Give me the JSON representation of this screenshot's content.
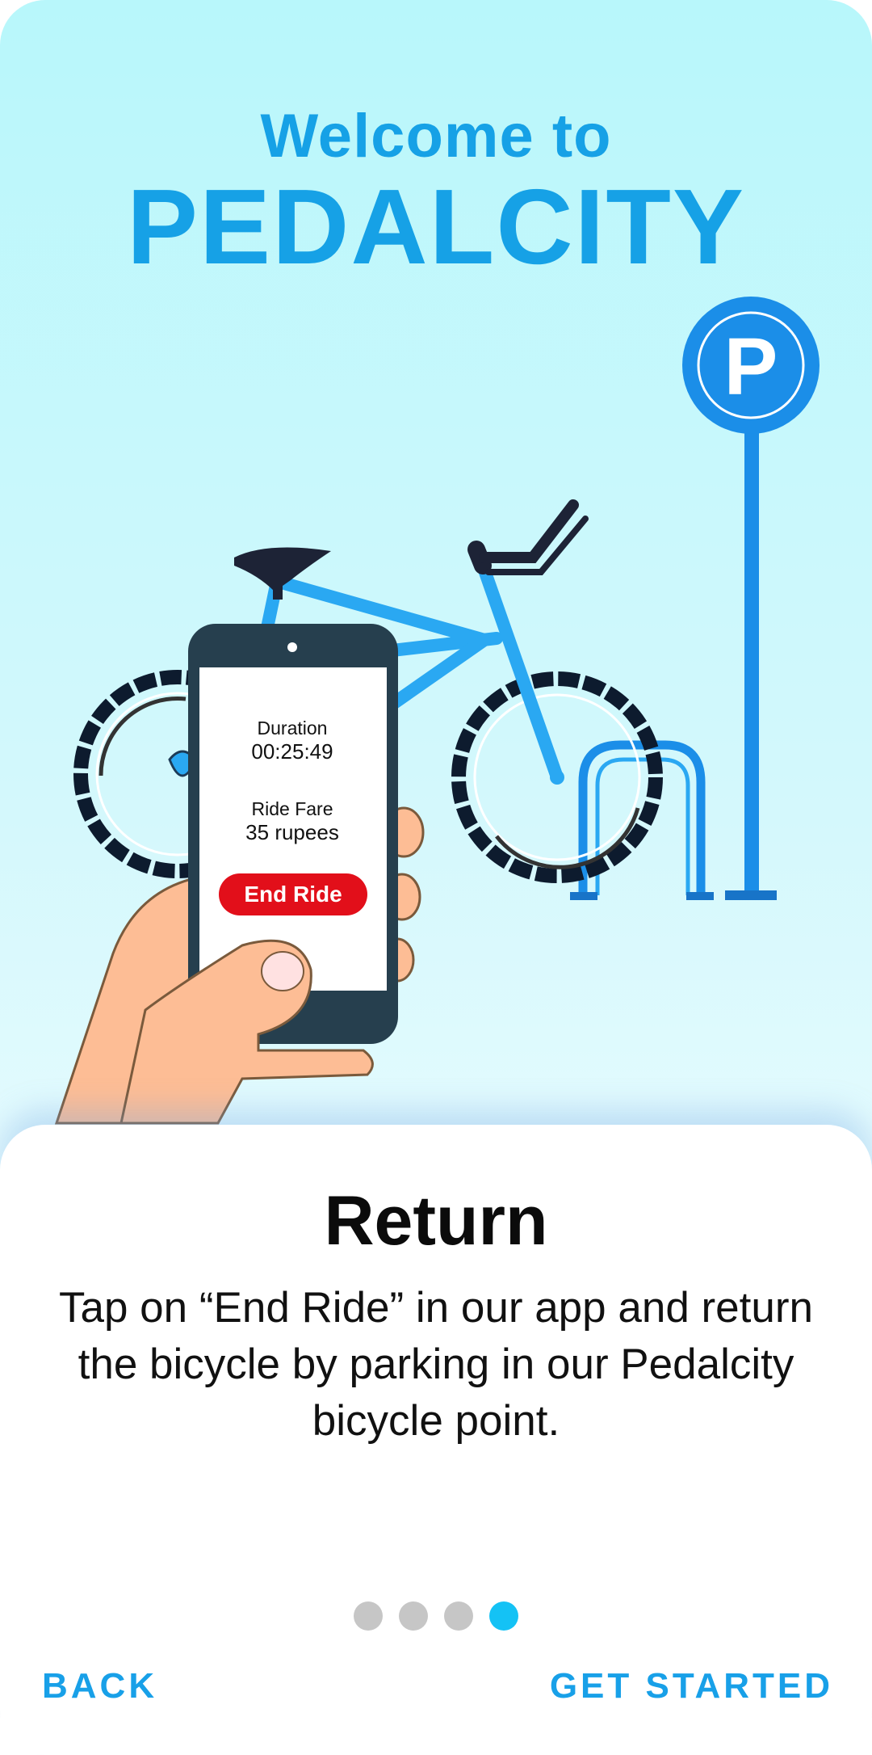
{
  "header": {
    "welcome": "Welcome to",
    "brand": "PEDALCITY"
  },
  "illustration": {
    "parking_sign_letter": "P",
    "phone": {
      "duration_label": "Duration",
      "duration_value": "00:25:49",
      "fare_label": "Ride Fare",
      "fare_value": "35 rupees",
      "end_ride_label": "End Ride"
    }
  },
  "onboarding": {
    "title": "Return",
    "description": "Tap on “End Ride” in our app and return the bicycle by parking in our Pedalcity bicycle point.",
    "pages_total": 4,
    "active_page": 4
  },
  "nav": {
    "back_label": "BACK",
    "get_started_label": "GET STARTED"
  },
  "colors": {
    "brand_blue": "#16a1e6",
    "end_ride_red": "#e20f1a",
    "active_dot": "#14c2f5",
    "inactive_dot": "#c6c6c6"
  }
}
